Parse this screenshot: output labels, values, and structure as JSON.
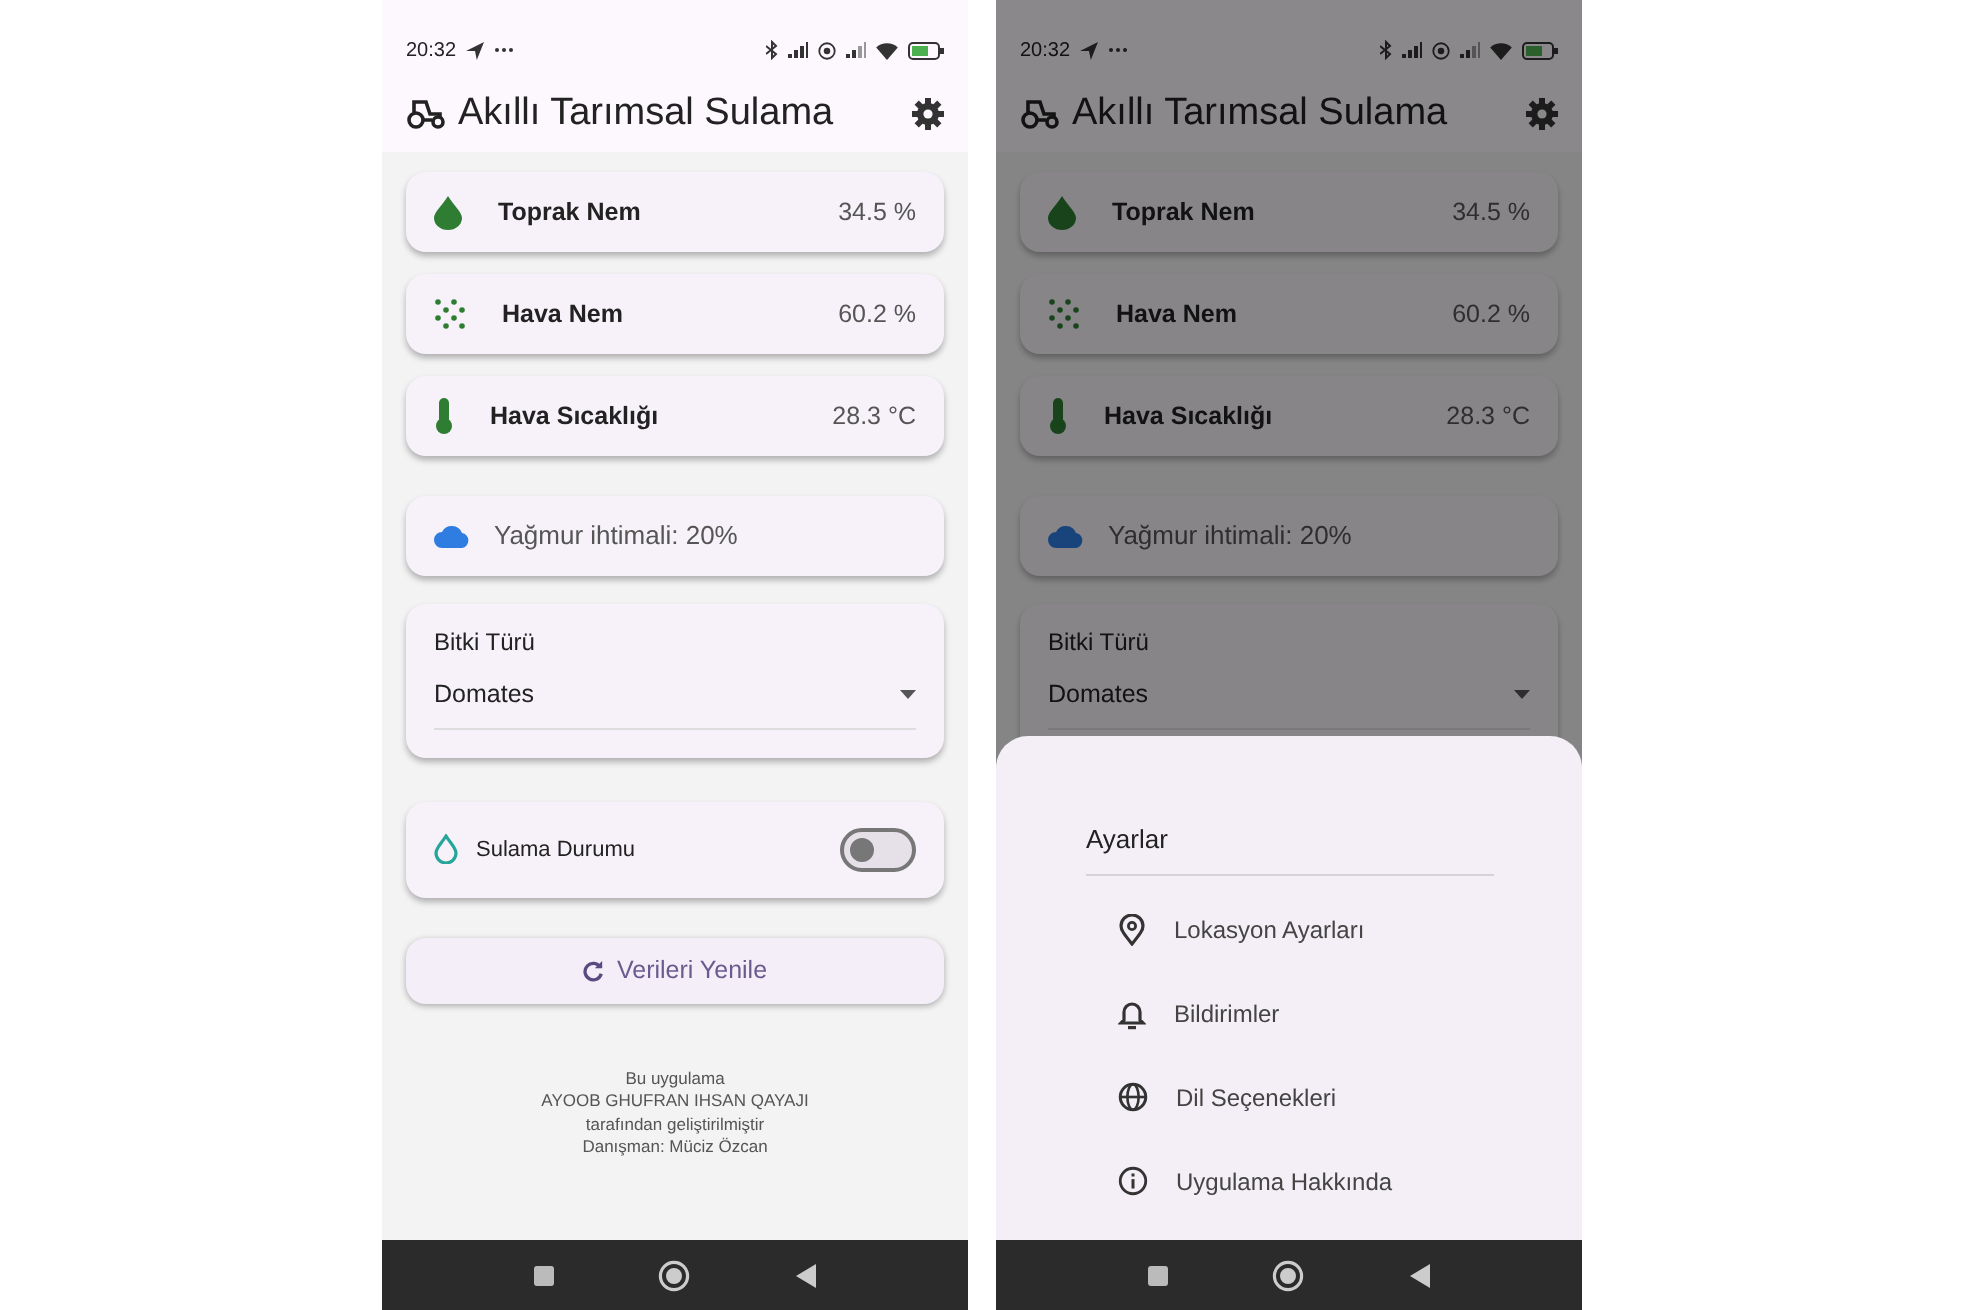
{
  "screens": [
    {
      "status_bar": {
        "time": "20:32"
      },
      "title": "Akıllı Tarımsal Sulama",
      "sensors": [
        {
          "label": "Toprak Nem",
          "value": "34.5 %"
        },
        {
          "label": "Hava Nem",
          "value": "60.2 %"
        },
        {
          "label": "Hava Sıcaklığı",
          "value": "28.3 °C"
        }
      ],
      "rain": "Yağmur ihtimali: 20%",
      "plant": {
        "label": "Bitki Türü",
        "value": "Domates"
      },
      "irrigation": {
        "label": "Sulama Durumu",
        "on": false
      },
      "refresh_button": "Verileri Yenile",
      "footer": [
        "Bu uygulama",
        "AYOOB GHUFRAN IHSAN QAYAJI",
        "tarafından geliştirilmiştir",
        "Danışman: Müciz Özcan"
      ]
    },
    {
      "status_bar": {
        "time": "20:32"
      },
      "title": "Akıllı Tarımsal Sulama",
      "sensors": [
        {
          "label": "Toprak Nem",
          "value": "34.5 %"
        },
        {
          "label": "Hava Nem",
          "value": "60.2 %"
        },
        {
          "label": "Hava Sıcaklığı",
          "value": "28.3 °C"
        }
      ],
      "rain": "Yağmur ihtimali: 20%",
      "plant": {
        "label": "Bitki Türü",
        "value": "Domates"
      },
      "settings_sheet": {
        "title": "Ayarlar",
        "items": [
          {
            "label": "Lokasyon Ayarları"
          },
          {
            "label": "Bildirimler"
          },
          {
            "label": "Dil Seçenekleri"
          },
          {
            "label": "Uygulama Hakkında"
          }
        ]
      }
    }
  ]
}
